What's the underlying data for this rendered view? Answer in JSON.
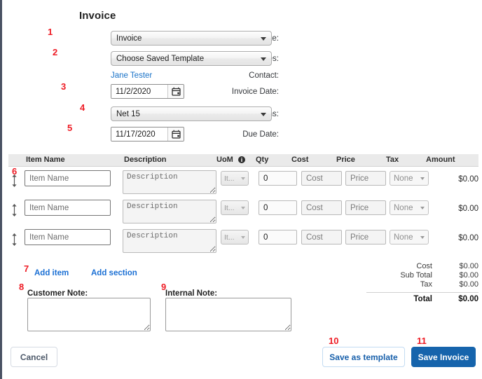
{
  "page": {
    "title": "Invoice"
  },
  "form": {
    "design_template": {
      "label": "Design Template:",
      "value": "Invoice"
    },
    "saved_invoices": {
      "label": "Saved Invoices:",
      "value": "Choose Saved Template"
    },
    "contact": {
      "label": "Contact:",
      "value": "Jane Tester"
    },
    "invoice_date": {
      "label": "Invoice Date:",
      "value": "11/2/2020"
    },
    "terms": {
      "label": "Terms:",
      "value": "Net 15"
    },
    "due_date": {
      "label": "Due Date:",
      "value": "11/17/2020"
    }
  },
  "table": {
    "headers": {
      "item_name": "Item Name",
      "description": "Description",
      "uom": "UoM",
      "uom_icon": "info-icon",
      "qty": "Qty",
      "cost": "Cost",
      "price": "Price",
      "tax": "Tax",
      "amount": "Amount"
    },
    "rows": [
      {
        "item_name_placeholder": "Item Name",
        "description_placeholder": "Description",
        "uom_value": "It...",
        "qty_value": "0",
        "cost_placeholder": "Cost",
        "price_placeholder": "Price",
        "tax_value": "None",
        "amount": "$0.00"
      },
      {
        "item_name_placeholder": "Item Name",
        "description_placeholder": "Description",
        "uom_value": "It...",
        "qty_value": "0",
        "cost_placeholder": "Cost",
        "price_placeholder": "Price",
        "tax_value": "None",
        "amount": "$0.00"
      },
      {
        "item_name_placeholder": "Item Name",
        "description_placeholder": "Description",
        "uom_value": "It...",
        "qty_value": "0",
        "cost_placeholder": "Cost",
        "price_placeholder": "Price",
        "tax_value": "None",
        "amount": "$0.00"
      }
    ]
  },
  "actions": {
    "add_item": "Add item",
    "add_section": "Add section"
  },
  "totals": {
    "cost_label": "Cost",
    "cost_value": "$0.00",
    "subtotal_label": "Sub Total",
    "subtotal_value": "$0.00",
    "tax_label": "Tax",
    "tax_value": "$0.00",
    "total_label": "Total",
    "total_value": "$0.00"
  },
  "notes": {
    "customer_label": "Customer Note:",
    "customer_value": "",
    "internal_label": "Internal Note:",
    "internal_value": ""
  },
  "buttons": {
    "cancel": "Cancel",
    "save_as_template": "Save as template",
    "save_invoice": "Save Invoice"
  },
  "annotations": {
    "a1": "1",
    "a2": "2",
    "a3": "3",
    "a4": "4",
    "a5": "5",
    "a6": "6",
    "a7": "7",
    "a8": "8",
    "a9": "9",
    "a10": "10",
    "a11": "11"
  },
  "colors": {
    "annotation_red": "#ee1c25",
    "link_blue": "#1a6fd4",
    "primary_button": "#1664ac"
  }
}
